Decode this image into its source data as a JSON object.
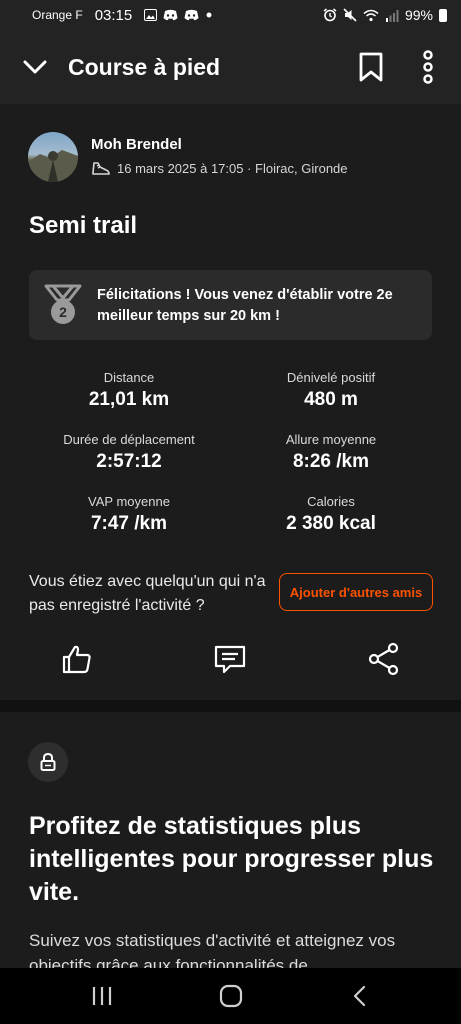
{
  "status_bar": {
    "carrier": "Orange F",
    "time": "03:15",
    "battery": "99%",
    "left_icons": [
      "image-icon",
      "discord-icon",
      "discord-icon",
      "dot-icon"
    ],
    "right_icons": [
      "alarm-icon",
      "mute-icon",
      "wifi-icon",
      "signal-icon",
      "battery-icon"
    ]
  },
  "app_bar": {
    "title": "Course à pied"
  },
  "activity": {
    "athlete": "Moh Brendel",
    "meta": "16 mars 2025 à 17:05 · Floirac, Gironde",
    "title": "Semi trail",
    "achievement": {
      "rank": "2",
      "text": "Félicitations ! Vous venez d'établir votre 2e meilleur temps sur 20 km !"
    },
    "stats": [
      {
        "label": "Distance",
        "value": "21,01 km"
      },
      {
        "label": "Dénivelé positif",
        "value": "480 m"
      },
      {
        "label": "Durée de déplacement",
        "value": "2:57:12"
      },
      {
        "label": "Allure moyenne",
        "value": "8:26 /km"
      },
      {
        "label": "VAP moyenne",
        "value": "7:47 /km"
      },
      {
        "label": "Calories",
        "value": "2 380 kcal"
      }
    ],
    "companion_prompt": "Vous étiez avec quelqu'un qui n'a pas enregistré l'activité ?",
    "add_friends_label": "Ajouter d'autres amis"
  },
  "promo": {
    "heading": "Profitez de statistiques plus intelligentes pour progresser plus vite.",
    "body": "Suivez vos statistiques d'activité et atteignez vos objectifs grâce aux fonctionnalités de"
  },
  "colors": {
    "accent": "#fc5200",
    "background": "#111111",
    "card": "#1c1c1c",
    "app_bar": "#232323"
  }
}
